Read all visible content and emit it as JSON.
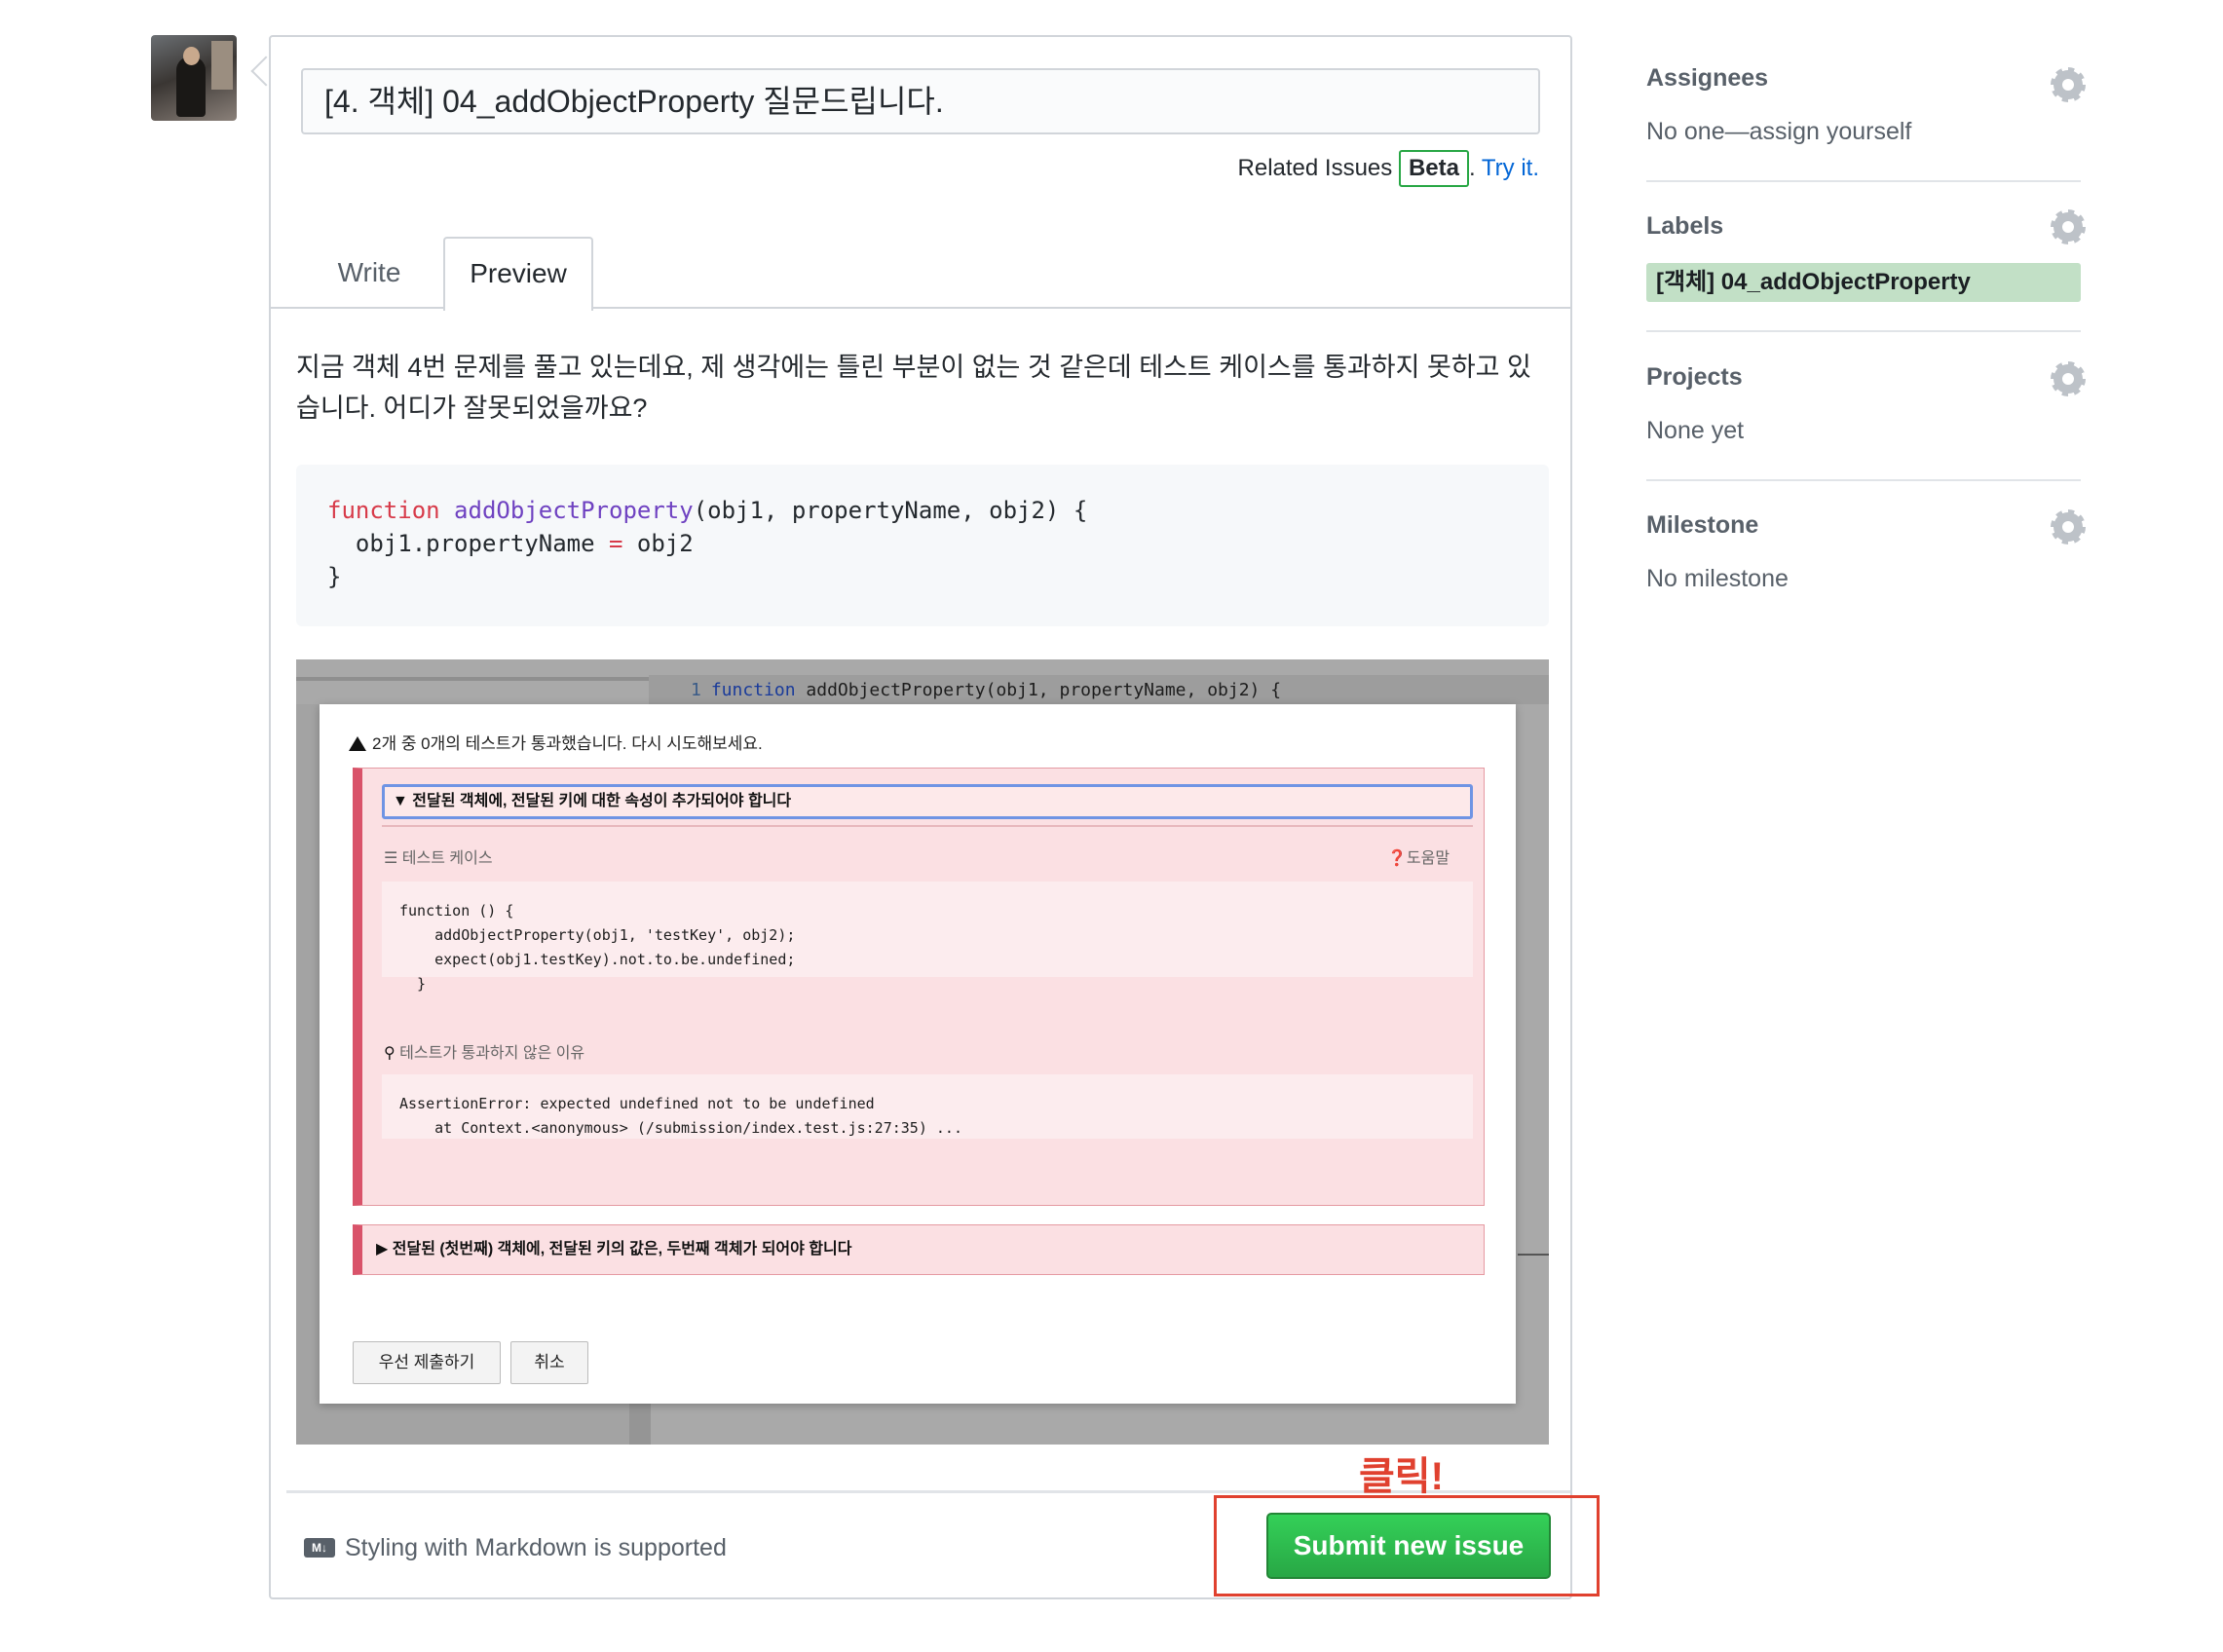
{
  "issue": {
    "title": "[4. 객체] 04_addObjectProperty 질문드립니다.",
    "related_issues_text": "Related Issues",
    "beta_badge": "Beta",
    "try_link": "Try it.",
    "tabs": [
      "Write",
      "Preview"
    ],
    "active_tab": "Preview",
    "description": "지금 객체 4번 문제를 풀고 있는데요, 제 생각에는 틀린 부분이 없는 것 같은데 테스트 케이스를 통과하지 못하고 있습니다. 어디가 잘못되었을까요?",
    "code": {
      "keyword": "function",
      "func_name": "addObjectProperty",
      "signature_rest": "(obj1, propertyName, obj2) {",
      "line2_left": "  obj1.propertyName",
      "line2_op": "=",
      "line2_right": "obj2",
      "line3": "}"
    }
  },
  "embedded_screenshot": {
    "editor_line_number": "1",
    "editor_keyword": "function",
    "editor_code_rest": "addObjectProperty(obj1, propertyName, obj2) {",
    "modal_message": "2개 중 0개의 테스트가 통과했습니다. 다시 시도해보세요.",
    "test1_title": "▼ 전달된 객체에, 전달된 키에 대한 속성이 추가되어야 합니다",
    "test_case_label": "테스트 케이스",
    "help_label": "도움말",
    "test_code": "function () {\n    addObjectProperty(obj1, 'testKey', obj2);\n    expect(obj1.testKey).not.to.be.undefined;\n  }",
    "fail_reason_label": "테스트가 통과하지 않은 이유",
    "error_text": "AssertionError: expected undefined not to be undefined\n    at Context.<anonymous> (/submission/index.test.js:27:35) ...",
    "test2_title": "▶ 전달된 (첫번째) 객체에, 전달된 키의 값은, 두번째 객체가 되어야 합니다",
    "submit_anyway_button": "우선 제출하기",
    "cancel_button": "취소"
  },
  "footer": {
    "markdown_icon": "M↓",
    "markdown_note": "Styling with Markdown is supported",
    "submit_button": "Submit new issue",
    "annotation": "클릭!"
  },
  "sidebar": {
    "assignees": {
      "heading": "Assignees",
      "value": "No one—assign yourself"
    },
    "labels": {
      "heading": "Labels",
      "value": "[객체] 04_addObjectProperty",
      "color": "#c2e0c6"
    },
    "projects": {
      "heading": "Projects",
      "value": "None yet"
    },
    "milestone": {
      "heading": "Milestone",
      "value": "No milestone"
    }
  },
  "colors": {
    "submit_green": "#28a745",
    "annotation_red": "#e0412f",
    "link_blue": "#0366d6"
  }
}
